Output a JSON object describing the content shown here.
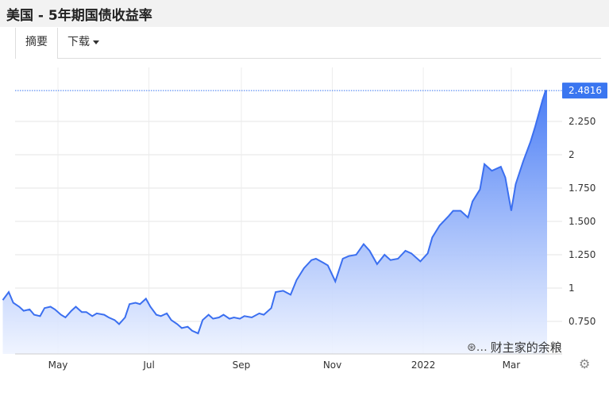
{
  "header": {
    "title": "美国 - 5年期国债收益率"
  },
  "tabs": {
    "summary": "摘要",
    "download": "下载"
  },
  "watermark": {
    "text": "财主家的余粮",
    "icon": "wechat-icon"
  },
  "settings": {
    "icon": "gear-icon"
  },
  "colors": {
    "line": "#3b6ff0",
    "fill_top": "#4a7df5",
    "fill_bottom": "#eef3ff",
    "label_bg": "#3a76f0",
    "ref_line": "#3a76f0"
  },
  "chart_data": {
    "type": "area",
    "title": "",
    "xlabel": "",
    "ylabel": "",
    "ylim": [
      0.55,
      2.65
    ],
    "y_ticks": [
      "0.750",
      "1",
      "1.250",
      "1.500",
      "1.750",
      "2",
      "2.250"
    ],
    "y_tick_values": [
      0.75,
      1.0,
      1.25,
      1.5,
      1.75,
      2.0,
      2.25
    ],
    "x_ticks": [
      "May",
      "Jul",
      "Sep",
      "Nov",
      "2022",
      "Mar"
    ],
    "x_tick_values": [
      "2021-05-01",
      "2021-07-01",
      "2021-09-01",
      "2021-11-01",
      "2022-01-01",
      "2022-03-01"
    ],
    "current_value_label": "2.4816",
    "current_value": 2.4816,
    "grid": true,
    "series": [
      {
        "x": [
          "2021-03-25",
          "2021-03-29",
          "2021-04-01",
          "2021-04-05",
          "2021-04-08",
          "2021-04-12",
          "2021-04-15",
          "2021-04-19",
          "2021-04-22",
          "2021-04-26",
          "2021-04-29",
          "2021-05-03",
          "2021-05-06",
          "2021-05-10",
          "2021-05-13",
          "2021-05-17",
          "2021-05-20",
          "2021-05-24",
          "2021-05-27",
          "2021-06-01",
          "2021-06-04",
          "2021-06-08",
          "2021-06-11",
          "2021-06-15",
          "2021-06-18",
          "2021-06-22",
          "2021-06-25",
          "2021-06-29",
          "2021-07-02",
          "2021-07-06",
          "2021-07-09",
          "2021-07-13",
          "2021-07-16",
          "2021-07-20",
          "2021-07-23",
          "2021-07-27",
          "2021-07-30",
          "2021-08-03",
          "2021-08-06",
          "2021-08-10",
          "2021-08-13",
          "2021-08-17",
          "2021-08-20",
          "2021-08-24",
          "2021-08-27",
          "2021-08-31",
          "2021-09-03",
          "2021-09-08",
          "2021-09-13",
          "2021-09-16",
          "2021-09-21",
          "2021-09-24",
          "2021-09-29",
          "2021-10-04",
          "2021-10-08",
          "2021-10-13",
          "2021-10-18",
          "2021-10-21",
          "2021-10-26",
          "2021-10-29",
          "2021-11-03",
          "2021-11-08",
          "2021-11-12",
          "2021-11-17",
          "2021-11-22",
          "2021-11-26",
          "2021-12-01",
          "2021-12-06",
          "2021-12-10",
          "2021-12-15",
          "2021-12-20",
          "2021-12-24",
          "2021-12-30",
          "2022-01-04",
          "2022-01-07",
          "2022-01-12",
          "2022-01-18",
          "2022-01-21",
          "2022-01-26",
          "2022-01-31",
          "2022-02-03",
          "2022-02-08",
          "2022-02-11",
          "2022-02-16",
          "2022-02-22",
          "2022-02-25",
          "2022-03-01",
          "2022-03-04",
          "2022-03-09",
          "2022-03-14",
          "2022-03-17",
          "2022-03-22",
          "2022-03-24",
          "2022-03-25"
        ],
        "values": [
          0.91,
          0.97,
          0.89,
          0.86,
          0.83,
          0.84,
          0.8,
          0.79,
          0.85,
          0.86,
          0.84,
          0.8,
          0.78,
          0.83,
          0.86,
          0.82,
          0.82,
          0.79,
          0.81,
          0.8,
          0.78,
          0.76,
          0.73,
          0.78,
          0.88,
          0.89,
          0.88,
          0.92,
          0.86,
          0.8,
          0.79,
          0.81,
          0.76,
          0.73,
          0.7,
          0.71,
          0.68,
          0.66,
          0.76,
          0.8,
          0.77,
          0.78,
          0.8,
          0.77,
          0.78,
          0.77,
          0.79,
          0.78,
          0.81,
          0.8,
          0.85,
          0.97,
          0.98,
          0.95,
          1.06,
          1.15,
          1.21,
          1.22,
          1.19,
          1.17,
          1.05,
          1.22,
          1.24,
          1.25,
          1.33,
          1.28,
          1.18,
          1.25,
          1.21,
          1.22,
          1.28,
          1.26,
          1.2,
          1.26,
          1.38,
          1.47,
          1.54,
          1.58,
          1.58,
          1.53,
          1.65,
          1.74,
          1.93,
          1.88,
          1.91,
          1.83,
          1.58,
          1.78,
          1.95,
          2.1,
          2.21,
          2.41,
          2.48,
          2.48
        ]
      }
    ]
  }
}
